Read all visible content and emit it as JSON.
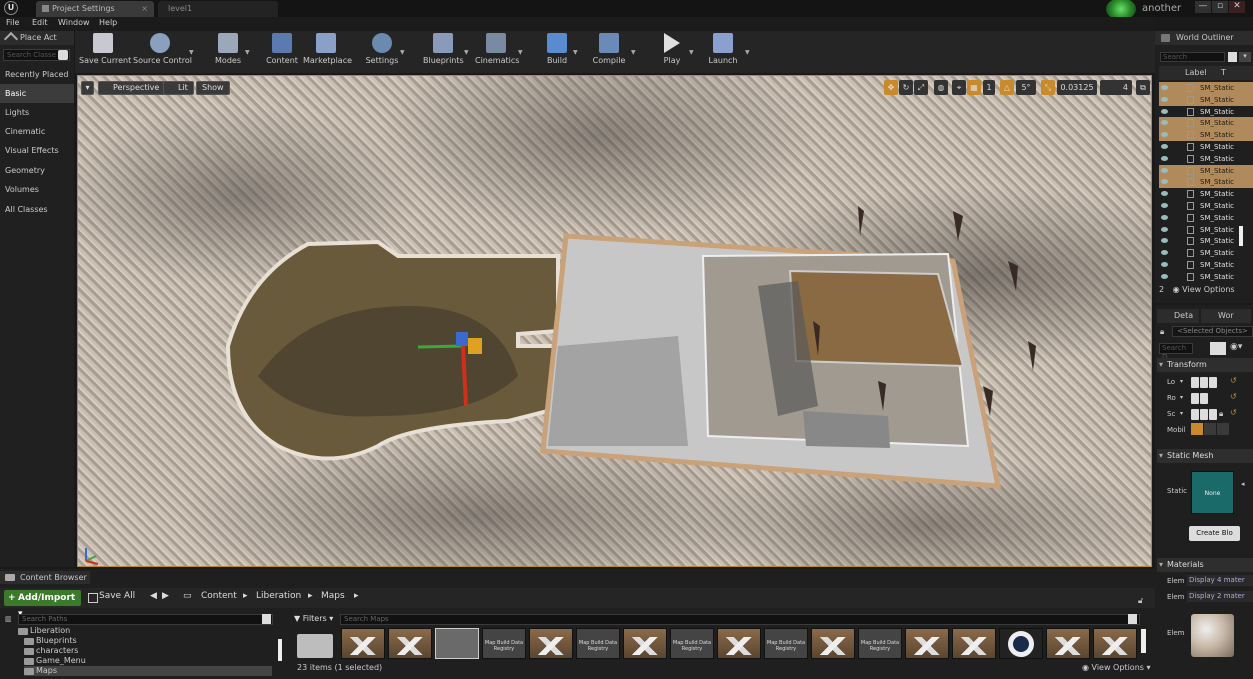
{
  "titlebar": {
    "tabs": [
      "Project Settings",
      "level1"
    ],
    "user": "another",
    "window_controls": [
      "—",
      "▫",
      "✕"
    ]
  },
  "menu": [
    "File",
    "Edit",
    "Window",
    "Help"
  ],
  "place_actors": {
    "title": "Place Act",
    "search_placeholder": "Search Classe",
    "categories": [
      "Recently Placed",
      "Basic",
      "Lights",
      "Cinematic",
      "Visual Effects",
      "Geometry",
      "Volumes",
      "All Classes"
    ],
    "selected": "Basic"
  },
  "toolbar": {
    "buttons": [
      "Save Current",
      "Source Control",
      "Modes",
      "Content",
      "Marketplace",
      "Settings",
      "Blueprints",
      "Cinematics",
      "Build",
      "Compile",
      "Play",
      "Launch"
    ],
    "icon_colors": [
      "#c8c8d0",
      "#8aa0c0",
      "#9aa8b8",
      "#5a7ab0",
      "#8aa0c8",
      "#6a8ab0",
      "#8a9ab8",
      "#7a8aa0",
      "#5a8ad0",
      "#6a8ab8",
      "#e0e0e0",
      "#8aa0d0"
    ]
  },
  "viewport": {
    "view_mode": "Perspective",
    "lighting": "Lit",
    "show": "Show",
    "grid_snap": "1",
    "rotation_snap": "5°",
    "scale_snap": "0.03125",
    "camera_speed": "4"
  },
  "outliner": {
    "title": "World Outliner",
    "search_placeholder": "Search",
    "col_label": "Label",
    "col_type": "T",
    "rows": [
      {
        "name": "SM_Static",
        "highlight": true
      },
      {
        "name": "SM_Static",
        "highlight": true
      },
      {
        "name": "SM_Static",
        "highlight": false
      },
      {
        "name": "SM_Static",
        "highlight": true
      },
      {
        "name": "SM_Static",
        "highlight": true
      },
      {
        "name": "SM_Static",
        "highlight": false
      },
      {
        "name": "SM_Static",
        "highlight": false
      },
      {
        "name": "SM_Static",
        "highlight": true
      },
      {
        "name": "SM_Static",
        "highlight": true
      },
      {
        "name": "SM_Static",
        "highlight": false
      },
      {
        "name": "SM_Static",
        "highlight": false
      },
      {
        "name": "SM_Static",
        "highlight": false
      },
      {
        "name": "SM_Static",
        "highlight": false
      },
      {
        "name": "SM_Static",
        "highlight": false
      },
      {
        "name": "SM_Static",
        "highlight": false
      },
      {
        "name": "SM_Static",
        "highlight": false
      },
      {
        "name": "SM_Static",
        "highlight": false
      }
    ],
    "count": "2",
    "view_options": "View Options"
  },
  "details": {
    "tab1": "Deta",
    "tab2": "Wor",
    "selected_objects": "<Selected Objects>",
    "search_placeholder": "Search D",
    "transform": "Transform",
    "location": "Lo",
    "rotation": "Ro",
    "scale": "Sc",
    "mobility": "Mobil",
    "static_mesh_section": "Static Mesh",
    "static_label": "Static",
    "mesh_value": "None",
    "create_blueprint": "Create Blo",
    "materials_section": "Materials",
    "element_label": "Elem",
    "materials": [
      "Display 4 mater",
      "Display 2 mater"
    ]
  },
  "content_browser": {
    "tab": "Content Browser",
    "add_import": "Add/Import",
    "save_all": "Save All",
    "breadcrumbs": [
      "Content",
      "Liberation",
      "Maps"
    ],
    "paths_placeholder": "Search Paths",
    "tree": [
      "Liberation",
      "Blueprints",
      "characters",
      "Game_Menu",
      "Maps"
    ],
    "filters": "Filters",
    "maps_placeholder": "Search Maps",
    "asset_label": "Map Build Data Registry",
    "status": "23 items (1 selected)",
    "view_options": "View Options"
  }
}
